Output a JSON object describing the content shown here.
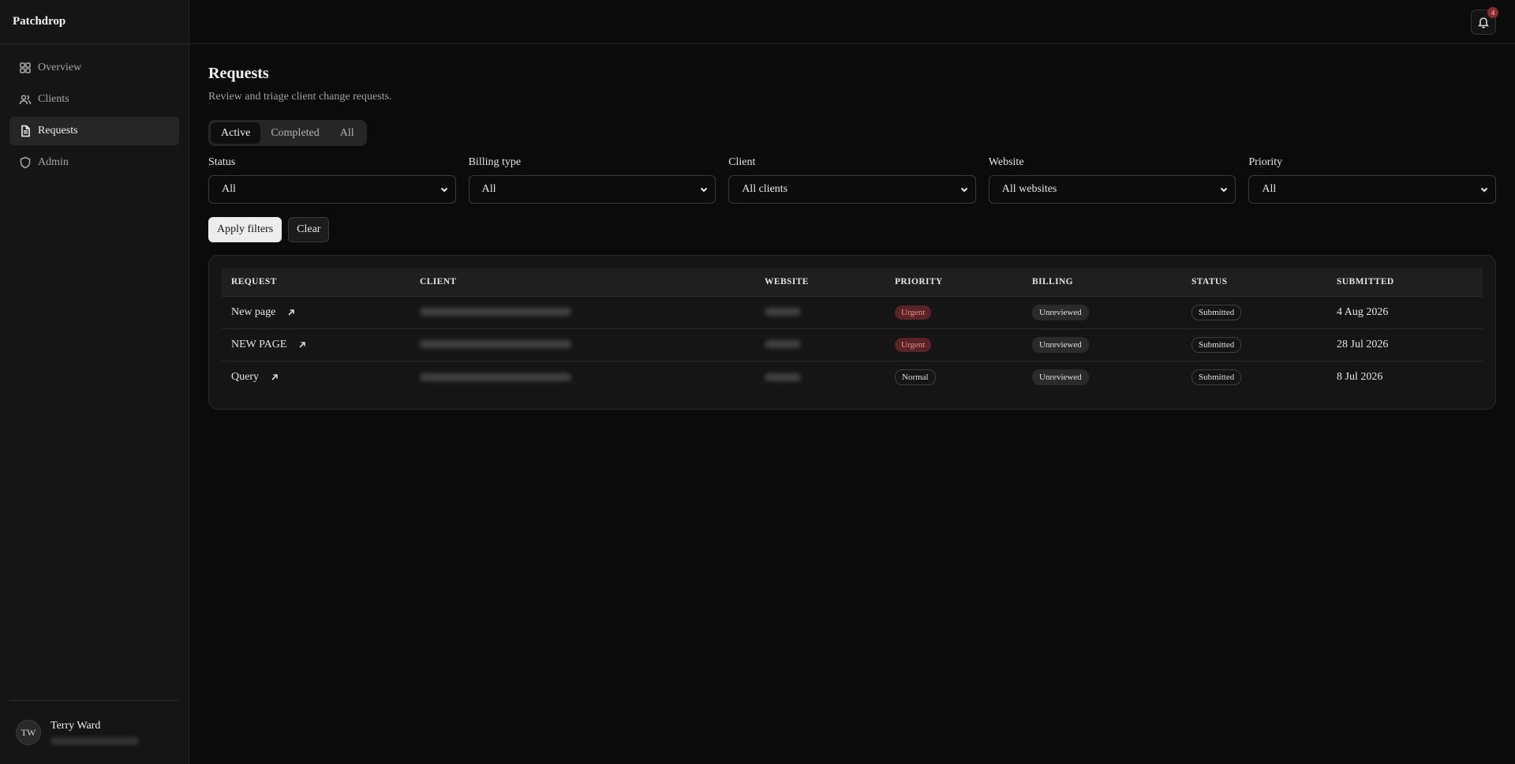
{
  "app": {
    "brand": "Patchdrop"
  },
  "sidebar": {
    "items": [
      {
        "label": "Overview",
        "icon": "grid-icon",
        "active": false
      },
      {
        "label": "Clients",
        "icon": "users-icon",
        "active": false
      },
      {
        "label": "Requests",
        "icon": "file-icon",
        "active": true
      },
      {
        "label": "Admin",
        "icon": "shield-icon",
        "active": false
      }
    ],
    "user": {
      "initials": "TW",
      "name": "Terry Ward"
    }
  },
  "topbar": {
    "notifications_count": "4"
  },
  "page": {
    "title": "Requests",
    "subtitle": "Review and triage client change requests."
  },
  "tabs": [
    {
      "label": "Active",
      "active": true
    },
    {
      "label": "Completed",
      "active": false
    },
    {
      "label": "All",
      "active": false
    }
  ],
  "filters": [
    {
      "label": "Status",
      "value": "All"
    },
    {
      "label": "Billing type",
      "value": "All"
    },
    {
      "label": "Client",
      "value": "All clients"
    },
    {
      "label": "Website",
      "value": "All websites"
    },
    {
      "label": "Priority",
      "value": "All"
    }
  ],
  "actions": {
    "apply_label": "Apply filters",
    "clear_label": "Clear"
  },
  "table": {
    "columns": [
      "REQUEST",
      "CLIENT",
      "WEBSITE",
      "PRIORITY",
      "BILLING",
      "STATUS",
      "SUBMITTED"
    ],
    "rows": [
      {
        "request": "New page",
        "priority": "Urgent",
        "billing": "Unreviewed",
        "status": "Submitted",
        "submitted": "4 Aug 2026"
      },
      {
        "request": "NEW PAGE",
        "priority": "Urgent",
        "billing": "Unreviewed",
        "status": "Submitted",
        "submitted": "28 Jul 2026"
      },
      {
        "request": "Query",
        "priority": "Normal",
        "billing": "Unreviewed",
        "status": "Submitted",
        "submitted": "8 Jul 2026"
      }
    ]
  },
  "colors": {
    "background": "#0b0b0b",
    "sidebar": "#151515",
    "urgent_bg": "#5a2426",
    "urgent_text": "#e08a8a",
    "primary_button": "#ededed"
  }
}
